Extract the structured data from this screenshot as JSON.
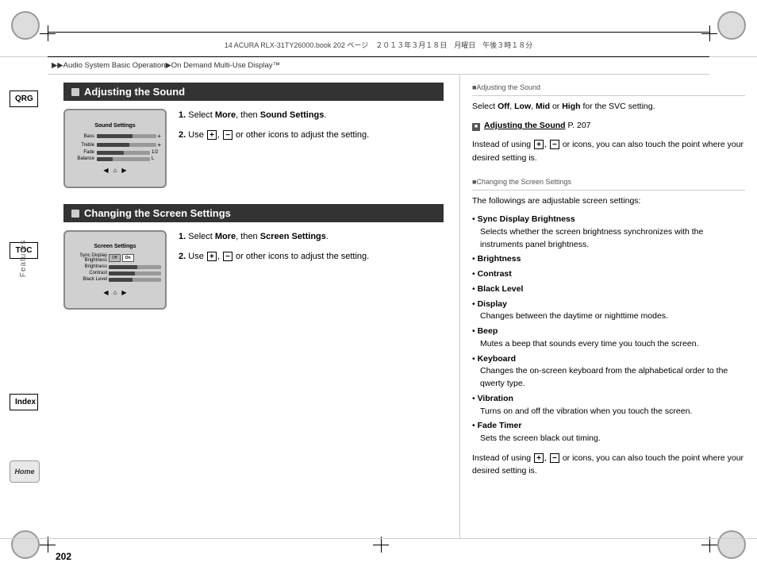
{
  "page": {
    "number": "202",
    "file_info": "14 ACURA RLX-31TY26000.book  202 ページ　２０１３年３月１８日　月曜日　午後３時１８分"
  },
  "breadcrumb": {
    "text": "▶▶Audio System Basic Operation▶On Demand Multi-Use Display™"
  },
  "sidebar": {
    "qrg_label": "QRG",
    "toc_label": "TOC",
    "index_label": "Index",
    "home_label": "Home",
    "features_label": "Features"
  },
  "section1": {
    "title": "Adjusting the Sound",
    "step1": "Select ",
    "step1_bold": "More",
    "step1_cont": ", then ",
    "step1_bold2": "Sound Settings",
    "step1_end": ".",
    "step2": "Use ",
    "step2_end": " or other icons to adjust the setting.",
    "mockup": {
      "title": "Sound Settings",
      "rows": [
        {
          "label": "Bass",
          "fill": 60,
          "value": ""
        },
        {
          "label": "Treble",
          "fill": 55,
          "value": ""
        },
        {
          "label": "Fade",
          "fill": 50,
          "value": "1/2"
        },
        {
          "label": "Balance",
          "fill": 45,
          "value": "L"
        }
      ]
    }
  },
  "section2": {
    "title": "Changing the Screen Settings",
    "step1": "Select ",
    "step1_bold": "More",
    "step1_cont": ", then ",
    "step1_bold2": "Screen Settings",
    "step1_end": ".",
    "step2": "Use ",
    "step2_end": " or other icons to adjust the setting.",
    "mockup": {
      "title": "Screen Settings",
      "rows": [
        {
          "label": "Sync Display Brightness",
          "type": "toggle",
          "options": [
            "Off",
            "On"
          ]
        },
        {
          "label": "Brightness",
          "fill": 55,
          "value": ""
        },
        {
          "label": "Contrast",
          "fill": 50,
          "value": ""
        },
        {
          "label": "Black Level",
          "fill": 45,
          "value": ""
        }
      ]
    }
  },
  "right_panel": {
    "section1_title": "■Adjusting the Sound",
    "section1_para1": "Select ",
    "section1_off": "Off",
    "section1_low": "Low",
    "section1_mid": "Mid",
    "section1_high": "High",
    "section1_svc": " for the SVC setting.",
    "section1_link_icon": "■",
    "section1_link_text": "Adjusting the Sound",
    "section1_link_page": "P. 207",
    "section1_para2_pre": "Instead of using ",
    "section1_para2_post": " or icons, you can also touch the point where your desired setting is.",
    "section2_title": "■Changing the Screen Settings",
    "section2_intro": "The followings are adjustable screen settings:",
    "section2_items": [
      {
        "bold": "Sync Display Brightness",
        "desc": "Selects whether the screen brightness synchronizes with the instruments panel brightness."
      },
      {
        "bold": "Brightness",
        "desc": ""
      },
      {
        "bold": "Contrast",
        "desc": ""
      },
      {
        "bold": "Black Level",
        "desc": ""
      },
      {
        "bold": "Display",
        "desc": "Changes between the daytime or nighttime modes."
      },
      {
        "bold": "Beep",
        "desc": "Mutes a beep that sounds every time you touch the screen."
      },
      {
        "bold": "Keyboard",
        "desc": "Changes the on-screen keyboard from the alphabetical order to the qwerty type."
      },
      {
        "bold": "Vibration",
        "desc": "Turns on and off the vibration when you touch the screen."
      },
      {
        "bold": "Fade Timer",
        "desc": "Sets the screen black out timing."
      }
    ],
    "section2_para_pre": "Instead of using ",
    "section2_para_post": " or icons, you can also touch the point where your desired setting is."
  }
}
